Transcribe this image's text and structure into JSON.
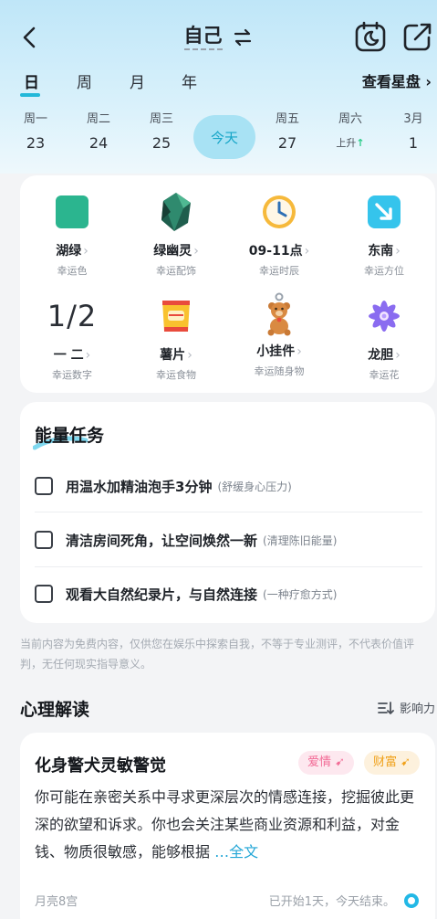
{
  "header": {
    "title": "自己",
    "tabs": [
      "日",
      "周",
      "月",
      "年"
    ],
    "active_tab": "日",
    "chart_link": "查看星盘"
  },
  "days": [
    {
      "weekday": "周一",
      "date": "23"
    },
    {
      "weekday": "周二",
      "date": "24"
    },
    {
      "weekday": "周三",
      "date": "25"
    },
    {
      "weekday": "今天",
      "date": ""
    },
    {
      "weekday": "周五",
      "date": "27"
    },
    {
      "weekday": "周六",
      "date": "",
      "note": "上升"
    },
    {
      "weekday": "3月",
      "date": "1"
    }
  ],
  "lucky": [
    {
      "value": "湖绿",
      "label": "幸运色",
      "icon": "color-swatch-icon"
    },
    {
      "value": "绿幽灵",
      "label": "幸运配饰",
      "icon": "crystal-icon"
    },
    {
      "value": "09-11点",
      "label": "幸运时辰",
      "icon": "clock-icon"
    },
    {
      "value": "东南",
      "label": "幸运方位",
      "icon": "direction-arrow-icon"
    },
    {
      "value": "一 二",
      "label": "幸运数字",
      "number_display": "1/2",
      "icon": "numbers"
    },
    {
      "value": "薯片",
      "label": "幸运食物",
      "icon": "chips-icon"
    },
    {
      "value": "小挂件",
      "label": "幸运随身物",
      "icon": "bear-pendant-icon"
    },
    {
      "value": "龙胆",
      "label": "幸运花",
      "icon": "flower-icon"
    }
  ],
  "energy": {
    "title": "能量任务",
    "tasks": [
      {
        "text": "用温水加精油泡手3分钟",
        "note": "(舒缓身心压力)"
      },
      {
        "text": "清洁房间死角，让空间焕然一新",
        "note": "(清理陈旧能量)"
      },
      {
        "text": "观看大自然纪录片，与自然连接",
        "note": "(一种疗愈方式)"
      }
    ]
  },
  "disclaimer": "当前内容为免费内容，仅供您在娱乐中探索自我，不等于专业测评，不代表价值评判，无任何现实指导意义。",
  "psych": {
    "title": "心理解读",
    "sort_label": "影响力"
  },
  "reading": {
    "title": "化身警犬灵敏警觉",
    "tags": [
      "爱情",
      "财富"
    ],
    "body": "你可能在亲密关系中寻求更深层次的情感连接，挖掘彼此更深的欲望和诉求。你也会关注某些商业资源和利益，对金钱、物质很敏感，能够根据",
    "more": "…全文",
    "foot_left": "月亮8宫",
    "foot_right": "已开始1天，今天结束。"
  },
  "colors": {
    "accent": "#22b8d9",
    "lake_green": "#2bb58f",
    "love": "#f26b96",
    "wealth": "#f0a11a"
  }
}
